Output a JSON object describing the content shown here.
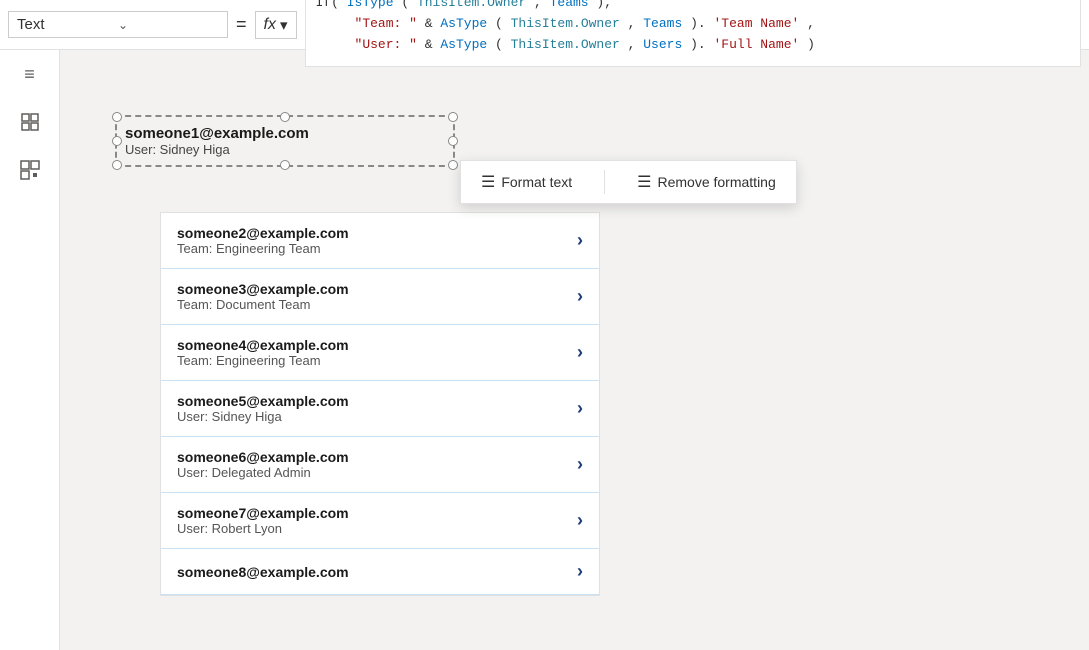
{
  "toolbar": {
    "text_label": "Text",
    "equals_symbol": "=",
    "fx_label": "fx",
    "fx_arrow": "▾",
    "dropdown_arrow": "⌄"
  },
  "formula": {
    "line1_prefix": "If(",
    "line1_func": "IsType",
    "line1_arg1": "ThisItem.Owner",
    "line1_keyword": "Teams",
    "line1_suffix": "),",
    "line2_string": "\"Team: \"",
    "line2_amp": " & ",
    "line2_func": "AsType",
    "line2_arg1": "ThisItem.Owner",
    "line2_keyword": "Teams",
    "line2_prop": ".'Team Name'",
    "line2_suffix": ",",
    "line3_string": "\"User: \"",
    "line3_amp": " & ",
    "line3_func": "AsType",
    "line3_arg1": "ThisItem.Owner",
    "line3_keyword": "Users",
    "line3_prop": ".'Full Name'",
    "line3_suffix": ")"
  },
  "format_popup": {
    "format_text_label": "Format text",
    "remove_formatting_label": "Remove formatting"
  },
  "selected_box": {
    "email": "someone1@example.com",
    "sub": "User: Sidney Higa"
  },
  "list_items": [
    {
      "email": "someone2@example.com",
      "sub": "Team: Engineering Team"
    },
    {
      "email": "someone3@example.com",
      "sub": "Team: Document Team"
    },
    {
      "email": "someone4@example.com",
      "sub": "Team: Engineering Team"
    },
    {
      "email": "someone5@example.com",
      "sub": "User: Sidney Higa"
    },
    {
      "email": "someone6@example.com",
      "sub": "User: Delegated Admin"
    },
    {
      "email": "someone7@example.com",
      "sub": "User: Robert Lyon"
    },
    {
      "email": "someone8@example.com",
      "sub": ""
    }
  ],
  "sidebar": {
    "icons": [
      "≡",
      "⊞",
      "⊡"
    ]
  }
}
